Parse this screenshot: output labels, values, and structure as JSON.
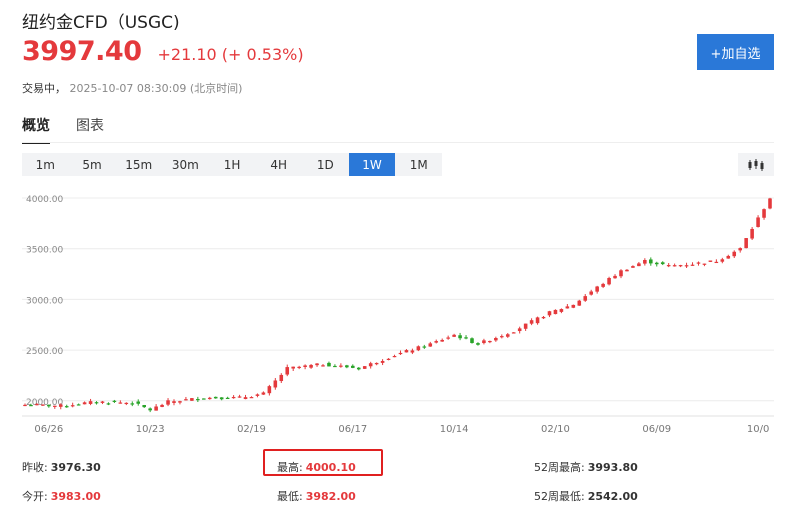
{
  "header": {
    "title": "纽约金CFD（USGC)",
    "price": "3997.40",
    "change": "+21.10 (+ 0.53%)",
    "status": "交易中，",
    "datetime": "2025-10-07 08:30:09",
    "timezone": "(北京时间)",
    "add_watchlist_label": "+加自选"
  },
  "tabs": [
    {
      "label": "概览",
      "active": true
    },
    {
      "label": "图表",
      "active": false
    }
  ],
  "periods": [
    {
      "label": "1m",
      "active": false
    },
    {
      "label": "5m",
      "active": false
    },
    {
      "label": "15m",
      "active": false
    },
    {
      "label": "30m",
      "active": false
    },
    {
      "label": "1H",
      "active": false
    },
    {
      "label": "4H",
      "active": false
    },
    {
      "label": "1D",
      "active": false
    },
    {
      "label": "1W",
      "active": true
    },
    {
      "label": "1M",
      "active": false
    }
  ],
  "chart_type_icon": "candlestick-icon",
  "colors": {
    "up": "#e4393c",
    "down": "#29a329",
    "accent": "#2a78d8"
  },
  "chart_data": {
    "type": "candlestick",
    "title": "",
    "y_ticks": [
      "4000.00",
      "3500.00",
      "3000.00",
      "2500.00",
      "2000.00"
    ],
    "y_tick_values": [
      4000,
      3500,
      3000,
      2500,
      2000
    ],
    "x_ticks": [
      "06/26",
      "10/23",
      "02/19",
      "06/17",
      "10/14",
      "02/10",
      "06/09",
      "10/0"
    ],
    "x_tick_index": [
      4,
      21,
      38,
      55,
      72,
      89,
      106,
      123
    ],
    "ylim": [
      1850,
      4000
    ],
    "grid": true,
    "anchors": [
      [
        0,
        1960
      ],
      [
        6,
        1950
      ],
      [
        12,
        1990
      ],
      [
        18,
        1980
      ],
      [
        21,
        1910
      ],
      [
        24,
        1990
      ],
      [
        30,
        2030
      ],
      [
        36,
        2030
      ],
      [
        40,
        2070
      ],
      [
        44,
        2320
      ],
      [
        50,
        2360
      ],
      [
        56,
        2320
      ],
      [
        62,
        2450
      ],
      [
        68,
        2560
      ],
      [
        72,
        2650
      ],
      [
        76,
        2560
      ],
      [
        82,
        2690
      ],
      [
        88,
        2870
      ],
      [
        92,
        2950
      ],
      [
        96,
        3120
      ],
      [
        100,
        3280
      ],
      [
        104,
        3380
      ],
      [
        108,
        3330
      ],
      [
        112,
        3350
      ],
      [
        116,
        3380
      ],
      [
        120,
        3500
      ],
      [
        125,
        4000
      ]
    ]
  },
  "stats": {
    "prev_close": {
      "label": "昨收:",
      "value": "3976.30"
    },
    "high": {
      "label": "最高:",
      "value": "4000.10"
    },
    "high52": {
      "label": "52周最高:",
      "value": "3993.80"
    },
    "open": {
      "label": "今开:",
      "value": "3983.00"
    },
    "low": {
      "label": "最低:",
      "value": "3982.00"
    },
    "low52": {
      "label": "52周最低:",
      "value": "2542.00"
    }
  }
}
